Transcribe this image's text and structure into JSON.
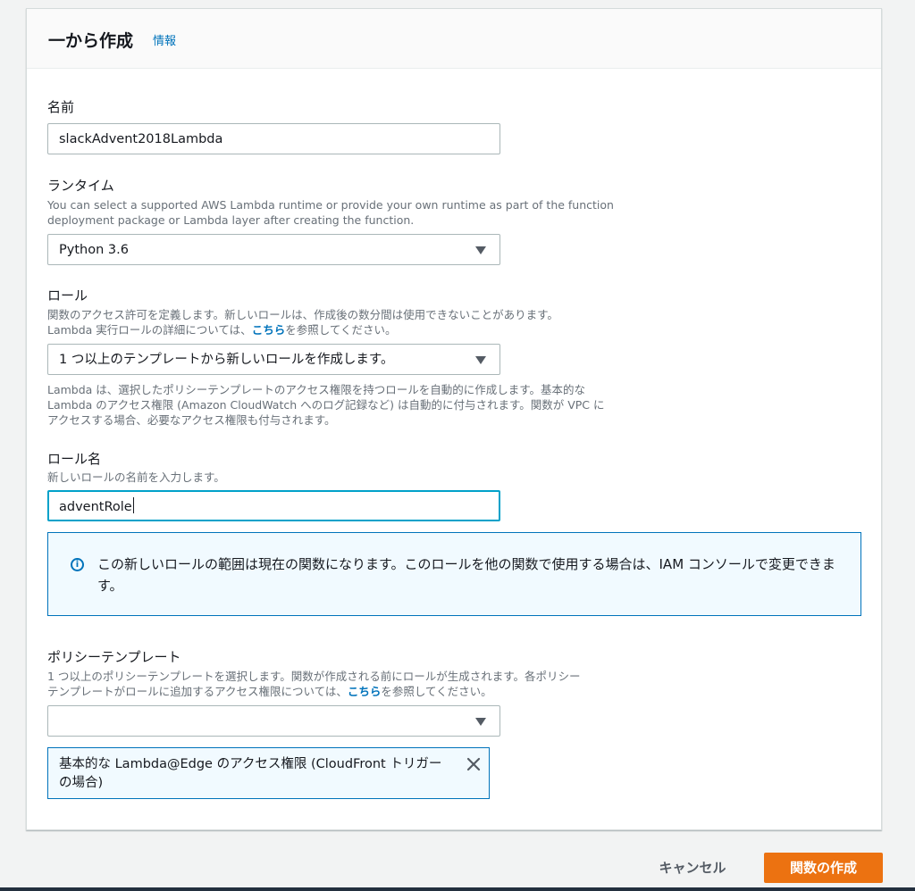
{
  "header": {
    "title": "一から作成",
    "info_link": "情報"
  },
  "name_field": {
    "label": "名前",
    "value": "slackAdvent2018Lambda"
  },
  "runtime": {
    "label": "ランタイム",
    "description_line1": "You can select a supported AWS Lambda runtime or provide your own runtime as part of the function",
    "description_line2": "deployment package or Lambda layer after creating the function.",
    "selected": "Python 3.6"
  },
  "role": {
    "label": "ロール",
    "description_line1": "関数のアクセス許可を定義します。新しいロールは、作成後の数分間は使用できないことがあります。",
    "description_line2_pre": "Lambda 実行ロールの詳細については、",
    "description_link": "こちら",
    "description_line2_post": "を参照してください。",
    "selected": "1 つ以上のテンプレートから新しいロールを作成します。",
    "help_line1": "Lambda は、選択したポリシーテンプレートのアクセス権限を持つロールを自動的に作成します。基本的な",
    "help_line2": "Lambda のアクセス権限 (Amazon CloudWatch へのログ記録など) は自動的に付与されます。関数が VPC に",
    "help_line3": "アクセスする場合、必要なアクセス権限も付与されます。"
  },
  "role_name": {
    "label": "ロール名",
    "description": "新しいロールの名前を入力します。",
    "value": "adventRole"
  },
  "info_alert": {
    "icon": "info-icon",
    "text": "この新しいロールの範囲は現在の関数になります。このロールを他の関数で使用する場合は、IAM コンソールで変更できます。"
  },
  "policy_templates": {
    "label": "ポリシーテンプレート",
    "description_line1": "1 つ以上のポリシーテンプレートを選択します。関数が作成される前にロールが生成されます。各ポリシー",
    "description_line2_pre": "テンプレートがロールに追加するアクセス権限については、",
    "description_link": "こちら",
    "description_line2_post": "を参照してください。",
    "selected": "",
    "token_label": "基本的な Lambda@Edge のアクセス権限 (CloudFront トリガーの場合)"
  },
  "footer": {
    "cancel_label": "キャンセル",
    "create_label": "関数の作成"
  },
  "colors": {
    "accent_blue": "#0073bb",
    "primary_orange": "#ec7211",
    "focus_border": "#00a1c9"
  }
}
